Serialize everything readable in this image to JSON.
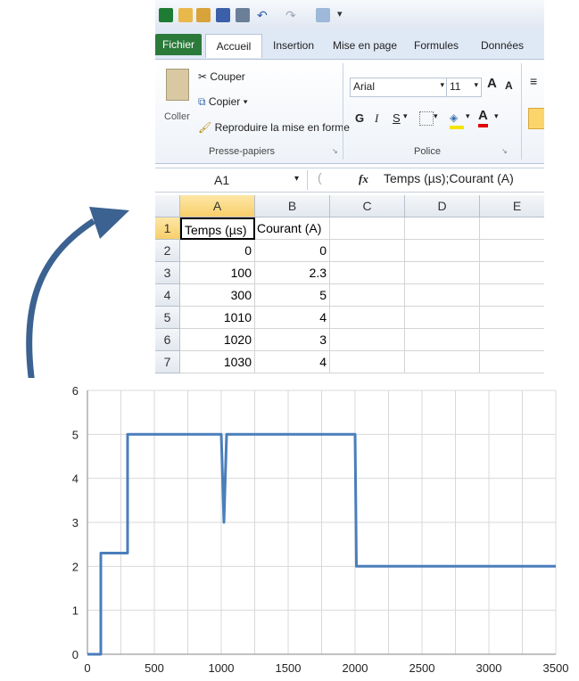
{
  "excel": {
    "tabs": [
      "Fichier",
      "Accueil",
      "Insertion",
      "Mise en page",
      "Formules",
      "Données"
    ],
    "clipboard": {
      "paste_label": "Coller",
      "cut_label": "Couper",
      "copy_label": "Copier",
      "format_painter_label": "Reproduire la mise en forme",
      "group_label": "Presse-papiers"
    },
    "font": {
      "family": "Arial",
      "size": "11",
      "bold": "G",
      "italic": "I",
      "underline": "S",
      "grow": "A",
      "shrink": "A",
      "color_letter": "A",
      "group_label": "Police"
    },
    "formula_bar": {
      "name_box": "A1",
      "fx": "fx",
      "content": "Temps (µs);Courant (A)"
    },
    "grid": {
      "columns": [
        "A",
        "B",
        "C",
        "D",
        "E"
      ],
      "rows": [
        {
          "n": "1",
          "a": "Temps (µs)",
          "b": "Courant (A)"
        },
        {
          "n": "2",
          "a": "0",
          "b": "0"
        },
        {
          "n": "3",
          "a": "100",
          "b": "2.3"
        },
        {
          "n": "4",
          "a": "300",
          "b": "5"
        },
        {
          "n": "5",
          "a": "1010",
          "b": "4"
        },
        {
          "n": "6",
          "a": "1020",
          "b": "3"
        },
        {
          "n": "7",
          "a": "1030",
          "b": "4"
        }
      ]
    },
    "colors": {
      "file_tab": "#2b7a3a",
      "selected_header": "#f8cf6a",
      "arrow": "#3b6290"
    }
  },
  "chart_data": {
    "type": "line",
    "title": "",
    "xlabel": "",
    "ylabel": "",
    "x": [
      0,
      100,
      100,
      300,
      300,
      1000,
      1010,
      1020,
      1030,
      1040,
      2000,
      2010,
      3500
    ],
    "series": [
      {
        "values": [
          0,
          0,
          2.3,
          2.3,
          5,
          5,
          4,
          3,
          4,
          5,
          5,
          2,
          2
        ],
        "color": "#4a7ebb"
      }
    ],
    "xlim": [
      0,
      3500
    ],
    "ylim": [
      0,
      6
    ],
    "xticks": [
      0,
      500,
      1000,
      1500,
      2000,
      2500,
      3000,
      3500
    ],
    "yticks": [
      0,
      1,
      2,
      3,
      4,
      5,
      6
    ],
    "grid": true
  }
}
